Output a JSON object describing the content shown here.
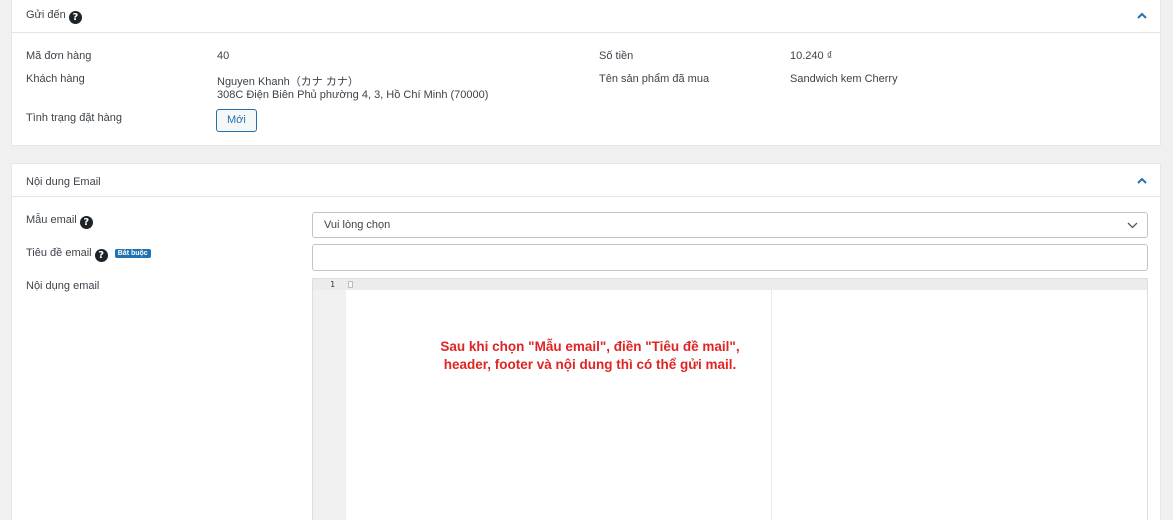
{
  "send_to": {
    "title": "Gửi đến",
    "help_icon": "?",
    "fields": {
      "order_id": {
        "label": "Mã đơn hàng",
        "value": "40"
      },
      "customer": {
        "label": "Khách hàng",
        "name": "Nguyen Khanh（カナ カナ）",
        "address": "308C Điện Biên Phủ phường 4, 3, Hồ Chí Minh (70000)"
      },
      "order_status": {
        "label": "Tình trạng đặt hàng",
        "value": "Mới"
      },
      "amount": {
        "label": "Số tiền",
        "value": "10.240 ₫"
      },
      "product": {
        "label": "Tên sản phẩm đã mua",
        "value": "Sandwich kem Cherry"
      }
    }
  },
  "email_content": {
    "title": "Nội dung Email",
    "template": {
      "label": "Mẫu email",
      "help_icon": "?",
      "selected": "Vui lòng chọn"
    },
    "subject": {
      "label": "Tiêu đề email",
      "help_icon": "?",
      "required_badge": "Bắt buộc",
      "value": ""
    },
    "body": {
      "label": "Nội dụng email",
      "line_number": "1"
    }
  },
  "annotation": {
    "line1": "Sau khi chọn \"Mẫu email\", điền \"Tiêu đề mail\",",
    "line2": "header, footer và nội dung thì có thể gửi mail."
  },
  "colors": {
    "accent": "#2271b1",
    "annotation": "#e02424",
    "background": "#f0f0f1"
  },
  "icons": [
    "help-icon",
    "chevron-up-icon",
    "chevron-down-icon"
  ]
}
